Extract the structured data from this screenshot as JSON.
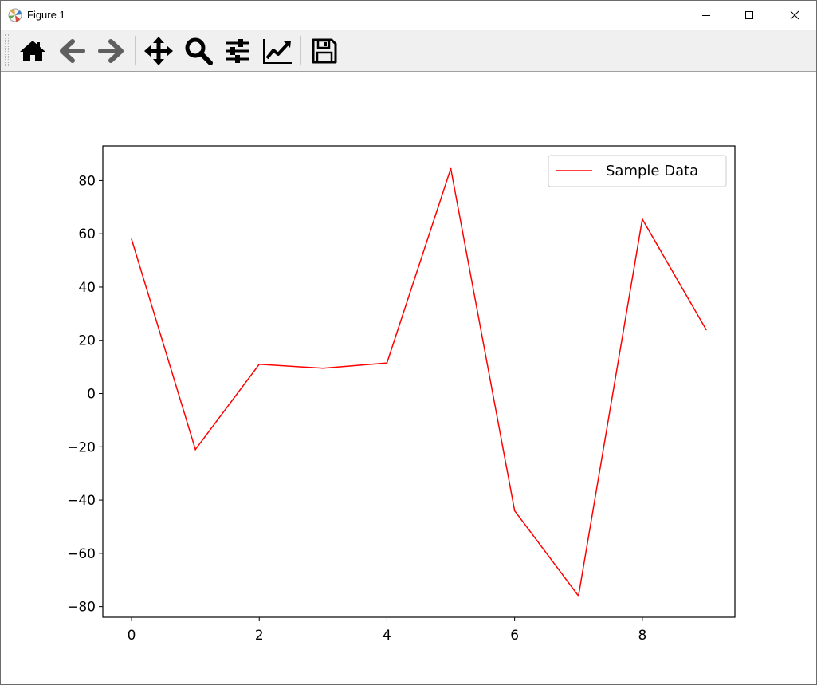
{
  "window": {
    "title": "Figure 1",
    "controls": [
      "minimize",
      "maximize",
      "close"
    ]
  },
  "toolbar": {
    "buttons": [
      {
        "name": "home",
        "icon": "home-icon"
      },
      {
        "name": "back",
        "icon": "arrow-left-icon"
      },
      {
        "name": "forward",
        "icon": "arrow-right-icon"
      },
      {
        "name": "pan",
        "icon": "move-icon"
      },
      {
        "name": "zoom",
        "icon": "magnifier-icon"
      },
      {
        "name": "configure-subplots",
        "icon": "sliders-icon"
      },
      {
        "name": "edit-axis",
        "icon": "line-chart-icon"
      },
      {
        "name": "save",
        "icon": "floppy-disk-icon"
      }
    ]
  },
  "chart_data": {
    "type": "line",
    "x": [
      0,
      1,
      2,
      3,
      4,
      5,
      6,
      7,
      8,
      9
    ],
    "series": [
      {
        "name": "Sample Data",
        "color": "#ff0000",
        "values": [
          58,
          -21,
          11,
          9.5,
          11.5,
          84.5,
          -44,
          -76,
          65.5,
          24
        ]
      }
    ],
    "xticks": [
      "0",
      "2",
      "4",
      "6",
      "8"
    ],
    "yticks": [
      "80",
      "60",
      "40",
      "20",
      "0",
      "−20",
      "−40",
      "−60",
      "−80"
    ],
    "xlim": [
      -0.45,
      9.45
    ],
    "ylim": [
      -84,
      93
    ],
    "title": "",
    "xlabel": "",
    "ylabel": "",
    "legend": "top-right",
    "grid": false
  }
}
